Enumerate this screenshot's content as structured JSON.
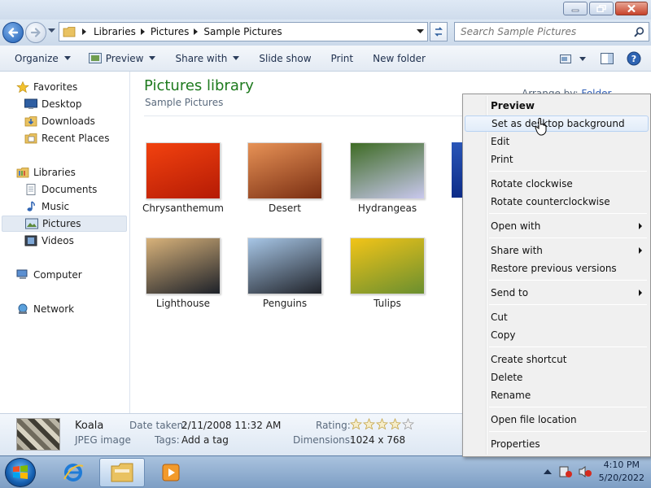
{
  "window": {
    "min": "minimize",
    "max": "maximize",
    "close": "close"
  },
  "address": {
    "crumbs": [
      "Libraries",
      "Pictures",
      "Sample Pictures"
    ],
    "search_placeholder": "Search Sample Pictures"
  },
  "toolbar": {
    "organize": "Organize",
    "preview": "Preview",
    "share_with": "Share with",
    "slide_show": "Slide show",
    "print": "Print",
    "new_folder": "New folder"
  },
  "nav": {
    "favorites": "Favorites",
    "desktop": "Desktop",
    "downloads": "Downloads",
    "recent_places": "Recent Places",
    "libraries": "Libraries",
    "documents": "Documents",
    "music": "Music",
    "pictures": "Pictures",
    "videos": "Videos",
    "computer": "Computer",
    "network": "Network"
  },
  "content": {
    "title": "Pictures library",
    "subtitle": "Sample Pictures",
    "arrange_label": "Arrange by:",
    "arrange_value": "Folder",
    "thumbnails": [
      {
        "name": "Chrysanthemum",
        "colors": [
          "#f2420f",
          "#b51b05"
        ]
      },
      {
        "name": "Desert",
        "colors": [
          "#e79256",
          "#7a2e12"
        ]
      },
      {
        "name": "Hydrangeas",
        "colors": [
          "#3e6b24",
          "#c9c8ee"
        ]
      },
      {
        "name": "Lighthouse",
        "colors": [
          "#d8b27a",
          "#1d2129"
        ]
      },
      {
        "name": "Penguins",
        "colors": [
          "#a7c6e6",
          "#20232a"
        ]
      },
      {
        "name": "Tulips",
        "colors": [
          "#f2c418",
          "#6a8f2f"
        ]
      }
    ]
  },
  "details": {
    "name": "Koala",
    "type": "JPEG image",
    "date_label": "Date taken:",
    "date_value": "2/11/2008 11:32 AM",
    "tags_label": "Tags:",
    "tags_value": "Add a tag",
    "rating_label": "Rating:",
    "rating_value": 0,
    "rating_max": 5,
    "dims_label": "Dimensions:",
    "dims_value": "1024 x 768"
  },
  "taskbar": {
    "time": "4:10 PM",
    "date": "5/20/2022"
  },
  "context_menu": {
    "items": [
      {
        "label": "Preview",
        "bold": true
      },
      {
        "label": "Set as desktop background",
        "highlighted": true
      },
      {
        "label": "Edit"
      },
      {
        "label": "Print"
      },
      {
        "label": "Rotate clockwise"
      },
      {
        "label": "Rotate counterclockwise"
      },
      {
        "label": "Open with",
        "submenu": true
      },
      {
        "label": "Share with",
        "submenu": true
      },
      {
        "label": "Restore previous versions"
      },
      {
        "label": "Send to",
        "submenu": true
      },
      {
        "label": "Cut"
      },
      {
        "label": "Copy"
      },
      {
        "label": "Create shortcut"
      },
      {
        "label": "Delete"
      },
      {
        "label": "Rename"
      },
      {
        "label": "Open file location"
      },
      {
        "label": "Properties"
      }
    ]
  }
}
